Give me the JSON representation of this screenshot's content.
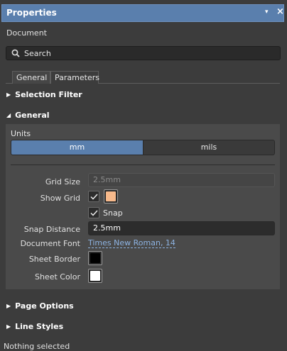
{
  "window": {
    "title": "Properties",
    "menu_glyph": "▾",
    "close_glyph": "×"
  },
  "context_label": "Document",
  "search": {
    "placeholder": "Search"
  },
  "tabs": [
    {
      "label": "General",
      "active": true
    },
    {
      "label": "Parameters",
      "active": false
    }
  ],
  "sections": {
    "selection_filter": "Selection Filter",
    "general": "General",
    "page_options": "Page Options",
    "line_styles": "Line Styles"
  },
  "general": {
    "units_label": "Units",
    "units_options": [
      "mm",
      "mils"
    ],
    "units_selected": "mm",
    "grid_size": {
      "label": "Grid Size",
      "value": "2.5mm",
      "disabled": true
    },
    "show_grid": {
      "label": "Show Grid",
      "checked": true,
      "color": "#f7b98b"
    },
    "snap": {
      "label": "Snap",
      "checked": true
    },
    "snap_distance": {
      "label": "Snap Distance",
      "value": "2.5mm"
    },
    "document_font": {
      "label": "Document Font",
      "value": "Times New Roman, 14"
    },
    "sheet_border": {
      "label": "Sheet Border",
      "color": "#000000"
    },
    "sheet_color": {
      "label": "Sheet Color",
      "color": "#ffffff"
    }
  },
  "status_bar": "Nothing selected"
}
